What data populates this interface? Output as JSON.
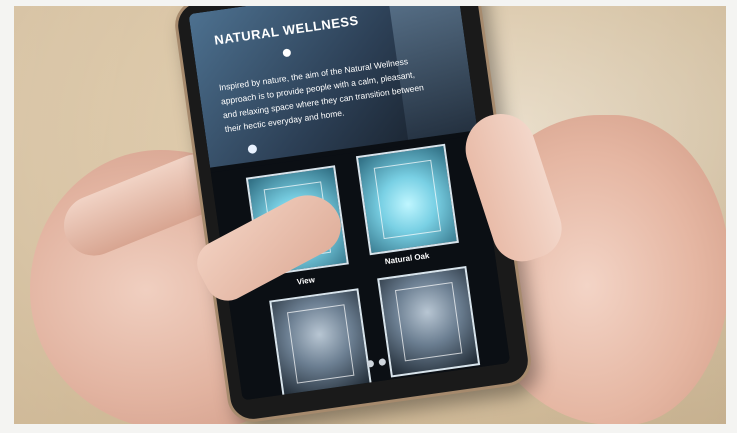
{
  "screen": {
    "hero": {
      "title": "NATURAL WELLNESS",
      "body": "Inspired by nature, the aim of the Natural Wellness approach is to provide people with a calm, pleasant, and relaxing space where they can transition between their hectic everyday and home."
    },
    "tiles": [
      {
        "label": "View"
      },
      {
        "label": "Natural Oak"
      },
      {
        "label": ""
      },
      {
        "label": ""
      }
    ],
    "pager": {
      "count": 2,
      "active": 0
    }
  },
  "colors": {
    "desk": "#dcc7a6",
    "phone_body": "#1a1a1a",
    "phone_trim": "#a68a6d",
    "screen_bg": "#0b0f14",
    "skin": "#e2b3a0"
  }
}
